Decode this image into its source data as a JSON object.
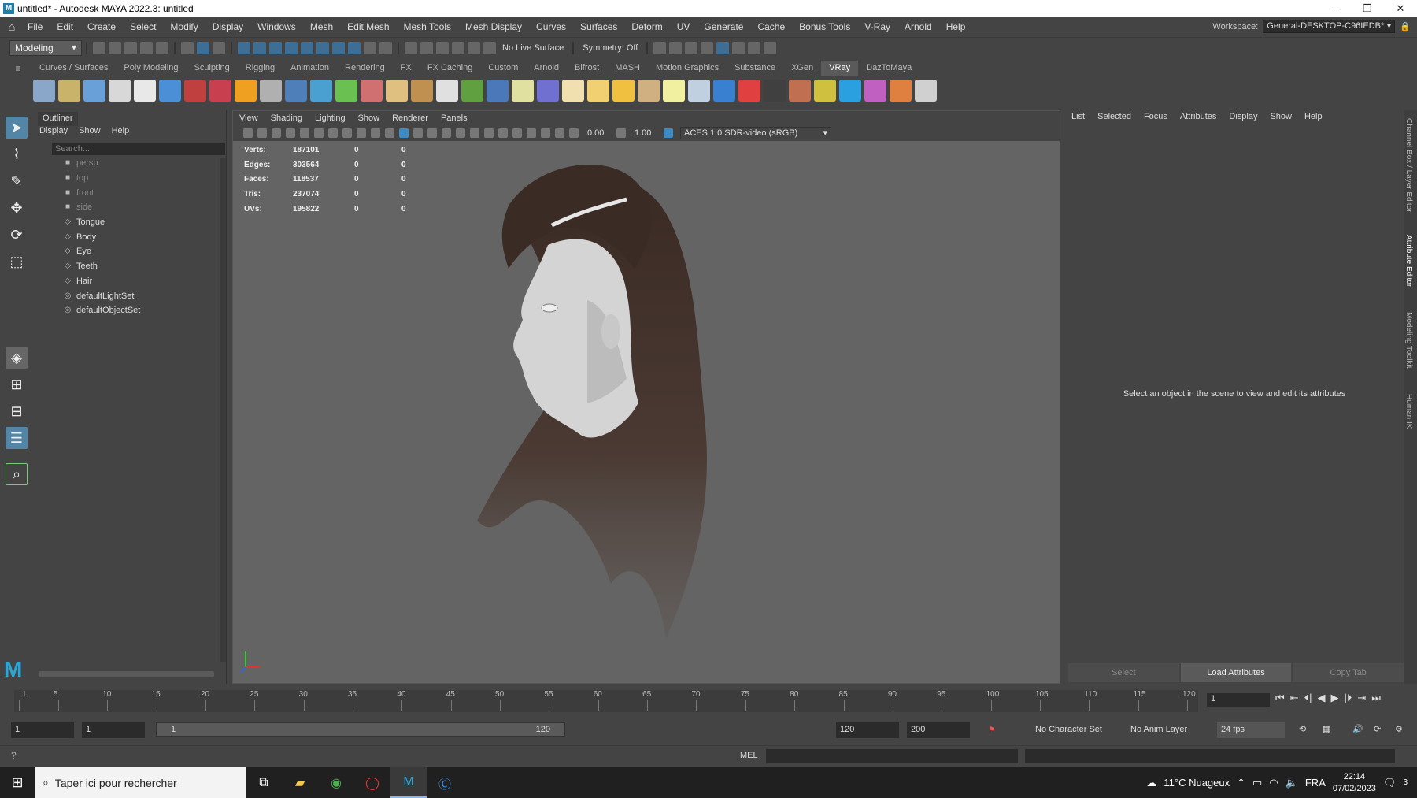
{
  "window": {
    "title": "untitled* - Autodesk MAYA 2022.3: untitled",
    "app_icon": "maya-icon",
    "controls": [
      "—",
      "❐",
      "✕"
    ]
  },
  "menubar": {
    "items": [
      "File",
      "Edit",
      "Create",
      "Select",
      "Modify",
      "Display",
      "Windows",
      "Mesh",
      "Edit Mesh",
      "Mesh Tools",
      "Mesh Display",
      "Curves",
      "Surfaces",
      "Deform",
      "UV",
      "Generate",
      "Cache",
      "Bonus Tools",
      "V-Ray",
      "Arnold",
      "Help"
    ]
  },
  "workspace": {
    "label": "Workspace:",
    "value": "General-DESKTOP-C96IEDB*"
  },
  "statusline": {
    "mode": "Modeling",
    "live_surface": "No Live Surface",
    "symmetry": "Symmetry: Off"
  },
  "shelf": {
    "tabs": [
      "Curves / Surfaces",
      "Poly Modeling",
      "Sculpting",
      "Rigging",
      "Animation",
      "Rendering",
      "FX",
      "FX Caching",
      "Custom",
      "Arnold",
      "Bifrost",
      "MASH",
      "Motion Graphics",
      "Substance",
      "XGen",
      "VRay",
      "DazToMaya"
    ],
    "active_tab": "VRay",
    "icon_colors": [
      "#8aa7c9",
      "#c9b26a",
      "#6aa0d8",
      "#d8d8d8",
      "#e8e8e8",
      "#4b8fd6",
      "#c04040",
      "#c84050",
      "#f0a020",
      "#b0b0b0",
      "#4f7fb8",
      "#4aa0d0",
      "#6ac050",
      "#d07070",
      "#e0c080",
      "#c09050",
      "#e0e0e0",
      "#60a040",
      "#4a78b8",
      "#e0e0a0",
      "#7070d0",
      "#f0e0b0",
      "#f0d070",
      "#f0c040",
      "#d0b080",
      "#f0f0a0",
      "#c0d0e0",
      "#3a80d0",
      "#e04040",
      "#404040",
      "#c07050",
      "#d0c040",
      "#2aa0e0",
      "#c060c0",
      "#e08040",
      "#d0d0d0"
    ]
  },
  "outliner": {
    "title": "Outliner",
    "menu": [
      "Display",
      "Show",
      "Help"
    ],
    "search_placeholder": "Search...",
    "items": [
      {
        "label": "persp",
        "type": "camera",
        "dim": true
      },
      {
        "label": "top",
        "type": "camera",
        "dim": true
      },
      {
        "label": "front",
        "type": "camera",
        "dim": true
      },
      {
        "label": "side",
        "type": "camera",
        "dim": true
      },
      {
        "label": "Tongue",
        "type": "mesh",
        "dim": false
      },
      {
        "label": "Body",
        "type": "mesh",
        "dim": false
      },
      {
        "label": "Eye",
        "type": "mesh",
        "dim": false
      },
      {
        "label": "Teeth",
        "type": "mesh",
        "dim": false
      },
      {
        "label": "Hair",
        "type": "mesh",
        "dim": false
      },
      {
        "label": "defaultLightSet",
        "type": "set",
        "dim": false
      },
      {
        "label": "defaultObjectSet",
        "type": "set",
        "dim": false
      }
    ]
  },
  "viewport": {
    "menu": [
      "View",
      "Shading",
      "Lighting",
      "Show",
      "Renderer",
      "Panels"
    ],
    "exposure": "0.00",
    "gamma": "1.00",
    "color_space": "ACES 1.0 SDR-video (sRGB)",
    "hud": [
      {
        "label": "Verts:",
        "v1": "187101",
        "v2": "0",
        "v3": "0"
      },
      {
        "label": "Edges:",
        "v1": "303564",
        "v2": "0",
        "v3": "0"
      },
      {
        "label": "Faces:",
        "v1": "118537",
        "v2": "0",
        "v3": "0"
      },
      {
        "label": "Tris:",
        "v1": "237074",
        "v2": "0",
        "v3": "0"
      },
      {
        "label": "UVs:",
        "v1": "195822",
        "v2": "0",
        "v3": "0"
      }
    ]
  },
  "attribute_editor": {
    "menu": [
      "List",
      "Selected",
      "Focus",
      "Attributes",
      "Display",
      "Show",
      "Help"
    ],
    "message": "Select an object in the scene to view and edit its attributes",
    "buttons": [
      "Select",
      "Load Attributes",
      "Copy Tab"
    ]
  },
  "side_tabs": [
    "Channel Box / Layer Editor",
    "Attribute Editor",
    "Modeling Toolkit",
    "Human IK"
  ],
  "timeline": {
    "ticks": [
      "1",
      "5",
      "10",
      "15",
      "20",
      "25",
      "30",
      "35",
      "40",
      "45",
      "50",
      "55",
      "60",
      "65",
      "70",
      "75",
      "80",
      "85",
      "90",
      "95",
      "100",
      "105",
      "110",
      "115",
      "120"
    ],
    "current_frame": "1"
  },
  "range": {
    "start": "1",
    "anim_start": "1",
    "slider_start": "1",
    "slider_end": "120",
    "anim_end": "120",
    "end": "200",
    "character_set": "No Character Set",
    "anim_layer": "No Anim Layer",
    "fps": "24 fps"
  },
  "cmdline": {
    "label": "MEL"
  },
  "taskbar": {
    "search": "Taper ici pour rechercher",
    "weather": "11°C Nuageux",
    "lang": "FRA",
    "time": "22:14",
    "date": "07/02/2023",
    "notif": "3"
  }
}
